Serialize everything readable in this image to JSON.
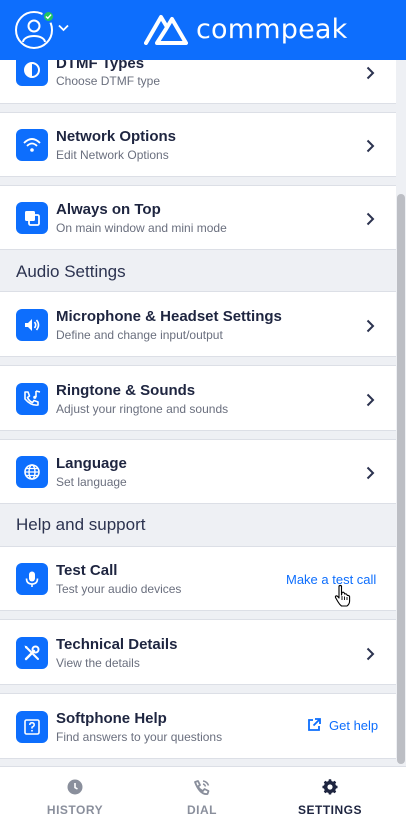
{
  "header": {
    "brand": "commpeak",
    "status_color": "#22c55e"
  },
  "rows": [
    {
      "title": "DTMF Types",
      "subtitle": "Choose DTMF type",
      "icon": "dtmf-icon"
    },
    {
      "title": "Network Options",
      "subtitle": "Edit Network Options",
      "icon": "wifi-icon"
    },
    {
      "title": "Always on Top",
      "subtitle": "On main window and mini mode",
      "icon": "window-stack-icon"
    },
    {
      "title": "Microphone & Headset Settings",
      "subtitle": "Define and change input/output",
      "icon": "speaker-icon"
    },
    {
      "title": "Ringtone & Sounds",
      "subtitle": "Adjust your ringtone and sounds",
      "icon": "phone-music-icon"
    },
    {
      "title": "Language",
      "subtitle": "Set language",
      "icon": "globe-icon"
    },
    {
      "title": "Test Call",
      "subtitle": "Test your audio devices",
      "icon": "microphone-icon",
      "action": "Make a test call"
    },
    {
      "title": "Technical Details",
      "subtitle": "View the details",
      "icon": "tools-icon"
    },
    {
      "title": "Softphone Help",
      "subtitle": "Find answers to your questions",
      "icon": "help-icon",
      "action": "Get help"
    }
  ],
  "sections": {
    "audio": "Audio Settings",
    "help": "Help and support"
  },
  "nav": [
    {
      "label": "HISTORY",
      "icon": "clock-icon",
      "active": false
    },
    {
      "label": "DIAL",
      "icon": "phone-dial-icon",
      "active": false
    },
    {
      "label": "SETTINGS",
      "icon": "gear-icon",
      "active": true
    }
  ],
  "colors": {
    "accent": "#0d6efd",
    "background": "#eef0f4"
  }
}
